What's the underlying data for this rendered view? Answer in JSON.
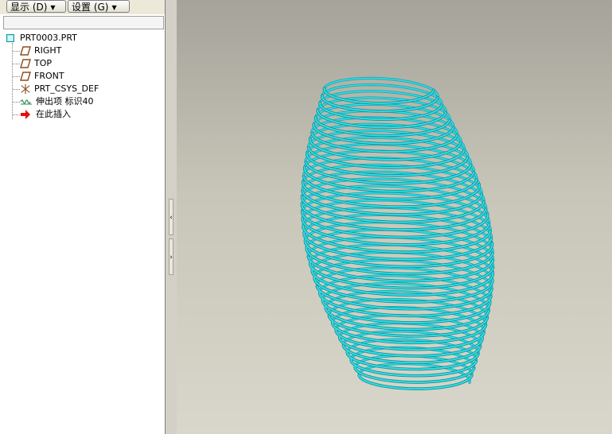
{
  "toolbar": {
    "display_label": "显示 (D)",
    "settings_label": "设置 (G)"
  },
  "tree": {
    "root": "PRT0003.PRT",
    "items": [
      {
        "label": "RIGHT",
        "icon": "datum-plane-icon"
      },
      {
        "label": "TOP",
        "icon": "datum-plane-icon"
      },
      {
        "label": "FRONT",
        "icon": "datum-plane-icon"
      },
      {
        "label": "PRT_CSYS_DEF",
        "icon": "coordinate-system-icon"
      },
      {
        "label": "伸出项 标识40",
        "icon": "sweep-protrusion-icon"
      },
      {
        "label": "在此插入",
        "icon": "insert-here-arrow-icon"
      }
    ]
  },
  "viewport": {
    "model": "helical-spring",
    "model_color": "#33e0e8",
    "background_top": "#a5a39a",
    "background_bottom": "#d9d7cb"
  }
}
